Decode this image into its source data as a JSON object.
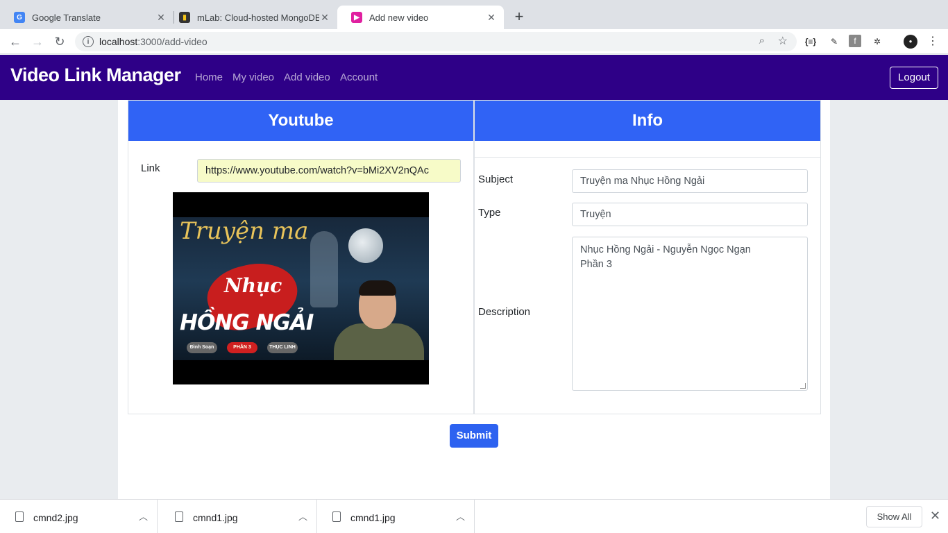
{
  "browser": {
    "tabs": [
      {
        "title": "Google Translate",
        "icon": "google-translate-icon"
      },
      {
        "title": "mLab: Cloud-hosted MongoDB",
        "icon": "mlab-icon"
      },
      {
        "title": "Add new video",
        "icon": "youtube-icon",
        "active": true
      }
    ],
    "url_host": "localhost",
    "url_rest": ":3000/add-video"
  },
  "navbar": {
    "brand": "Video Link Manager",
    "links": [
      "Home",
      "My video",
      "Add video",
      "Account"
    ],
    "logout": "Logout"
  },
  "youtube_card": {
    "header": "Youtube",
    "link_label": "Link",
    "link_value": "https://www.youtube.com/watch?v=bMi2XV2nQAc",
    "thumbnail": {
      "title_line1": "Truyện ma",
      "title_line2": "Nhục",
      "title_line3": "HỒNG NGẢI",
      "badges": [
        "Đình Soạn",
        "PHẦN 3",
        "THỤC LINH"
      ]
    }
  },
  "info_card": {
    "header": "Info",
    "subject_label": "Subject",
    "subject_value": "Truyện ma Nhục Hồng Ngải",
    "type_label": "Type",
    "type_value": "Truyện",
    "description_label": "Description",
    "description_line1": "Nhục Hồng Ngải - Nguyễn Ngọc Ngạn",
    "description_line2": "Phần 3"
  },
  "submit_label": "Submit",
  "downloads": {
    "items": [
      "cmnd2.jpg",
      "cmnd1.jpg",
      "cmnd1.jpg"
    ],
    "show_all": "Show All"
  },
  "colors": {
    "navbar": "#2e0087",
    "card_header": "#3063f5",
    "submit": "#2d62f0"
  }
}
